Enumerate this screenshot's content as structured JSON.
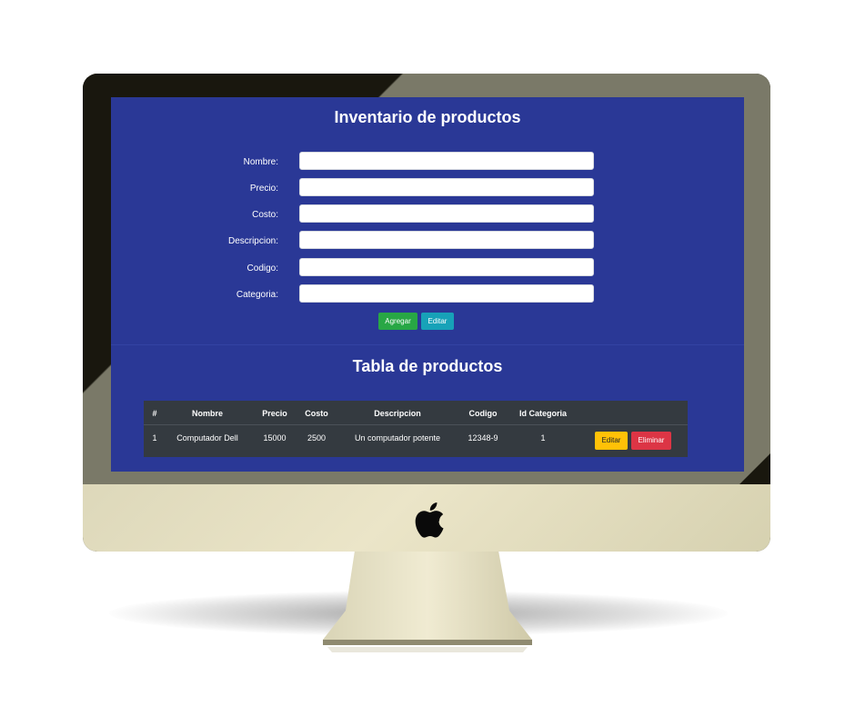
{
  "app": {
    "title": "Inventario de productos"
  },
  "form": {
    "fields": [
      {
        "label": "Nombre:",
        "value": "",
        "placeholder": ""
      },
      {
        "label": "Precio:",
        "value": "",
        "placeholder": ""
      },
      {
        "label": "Costo:",
        "value": "",
        "placeholder": ""
      },
      {
        "label": "Descripcion:",
        "value": "",
        "placeholder": ""
      },
      {
        "label": "Codigo:",
        "value": "",
        "placeholder": ""
      },
      {
        "label": "Categoria:",
        "value": "",
        "placeholder": ""
      }
    ],
    "add_label": "Agregar",
    "edit_label": "Editar"
  },
  "table": {
    "title": "Tabla de productos",
    "headers": [
      "#",
      "Nombre",
      "Precio",
      "Costo",
      "Descripcion",
      "Codigo",
      "Id Categoria"
    ],
    "rows": [
      {
        "cells": [
          "1",
          "Computador Dell",
          "15000",
          "2500",
          "Un computador potente",
          "12348-9",
          "1"
        ],
        "edit_label": "Editar",
        "delete_label": "Eliminar"
      }
    ]
  },
  "icons": {
    "brand_logo": "apple-icon"
  },
  "colors": {
    "screen_background": "#2a3896",
    "table_background": "#343a40",
    "add_button": "#28a745",
    "edit_button": "#17a2b8",
    "row_edit_button": "#ffc107",
    "row_delete_button": "#dc3545"
  }
}
